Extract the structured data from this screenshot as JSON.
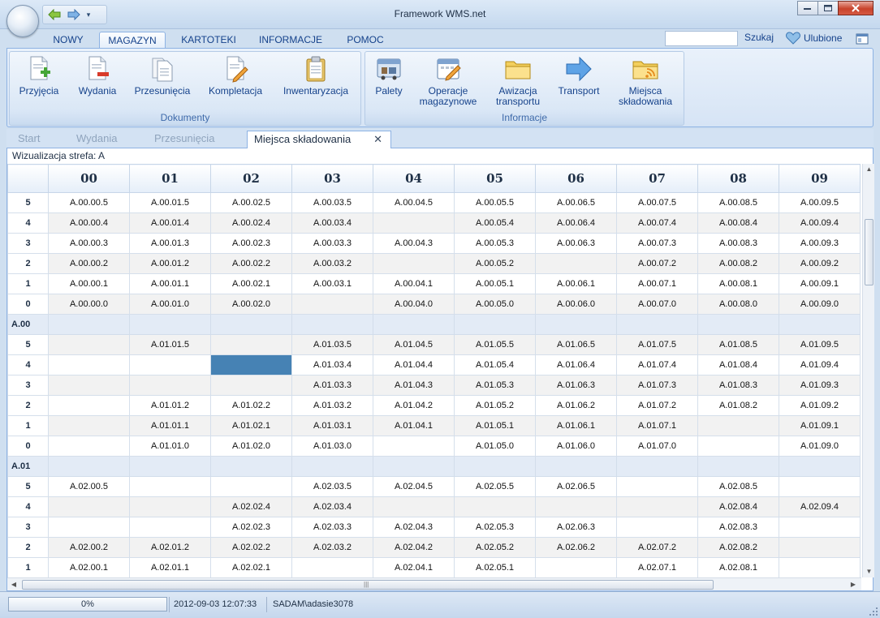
{
  "window": {
    "title": "Framework WMS.net"
  },
  "ribbon": {
    "tabs": [
      "NOWY",
      "MAGAZYN",
      "KARTOTEKI",
      "INFORMACJE",
      "POMOC"
    ],
    "active_tab": "MAGAZYN",
    "search": {
      "value": "",
      "label": "Szukaj"
    },
    "favorites_label": "Ulubione",
    "groups": [
      {
        "label": "Dokumenty",
        "buttons": [
          "Przyjęcia",
          "Wydania",
          "Przesunięcia",
          "Kompletacja",
          "Inwentaryzacja"
        ]
      },
      {
        "label": "Informacje",
        "buttons": [
          "Palety",
          "Operacje magazynowe",
          "Awizacja transportu",
          "Transport",
          "Miejsca składowania"
        ]
      }
    ]
  },
  "doc_tabs": [
    {
      "label": "Start",
      "active": false
    },
    {
      "label": "Wydania",
      "active": false
    },
    {
      "label": "Przesunięcia",
      "active": false
    },
    {
      "label": "Miejsca składowania",
      "active": true,
      "close": "✕"
    }
  ],
  "visualization": {
    "subtitle": "Wizualizacja strefa: A",
    "columns": [
      "00",
      "01",
      "02",
      "03",
      "04",
      "05",
      "06",
      "07",
      "08",
      "09"
    ],
    "rows": [
      {
        "label": "5",
        "cells": [
          "A.00.00.5",
          "A.00.01.5",
          "A.00.02.5",
          "A.00.03.5",
          "A.00.04.5",
          "A.00.05.5",
          "A.00.06.5",
          "A.00.07.5",
          "A.00.08.5",
          "A.00.09.5"
        ]
      },
      {
        "label": "4",
        "cells": [
          "A.00.00.4",
          "A.00.01.4",
          "A.00.02.4",
          "A.00.03.4",
          "",
          "A.00.05.4",
          "A.00.06.4",
          "A.00.07.4",
          "A.00.08.4",
          "A.00.09.4"
        ]
      },
      {
        "label": "3",
        "cells": [
          "A.00.00.3",
          "A.00.01.3",
          "A.00.02.3",
          "A.00.03.3",
          "A.00.04.3",
          "A.00.05.3",
          "A.00.06.3",
          "A.00.07.3",
          "A.00.08.3",
          "A.00.09.3"
        ]
      },
      {
        "label": "2",
        "cells": [
          "A.00.00.2",
          "A.00.01.2",
          "A.00.02.2",
          "A.00.03.2",
          "",
          "A.00.05.2",
          "",
          "A.00.07.2",
          "A.00.08.2",
          "A.00.09.2"
        ]
      },
      {
        "label": "1",
        "cells": [
          "A.00.00.1",
          "A.00.01.1",
          "A.00.02.1",
          "A.00.03.1",
          "A.00.04.1",
          "A.00.05.1",
          "A.00.06.1",
          "A.00.07.1",
          "A.00.08.1",
          "A.00.09.1"
        ]
      },
      {
        "label": "0",
        "cells": [
          "A.00.00.0",
          "A.00.01.0",
          "A.00.02.0",
          "",
          "A.00.04.0",
          "A.00.05.0",
          "A.00.06.0",
          "A.00.07.0",
          "A.00.08.0",
          "A.00.09.0"
        ]
      },
      {
        "label": "A.00",
        "group": true,
        "cells": [
          "",
          "",
          "",
          "",
          "",
          "",
          "",
          "",
          "",
          ""
        ]
      },
      {
        "label": "5",
        "cells": [
          "",
          "A.01.01.5",
          "",
          "A.01.03.5",
          "A.01.04.5",
          "A.01.05.5",
          "A.01.06.5",
          "A.01.07.5",
          "A.01.08.5",
          "A.01.09.5"
        ]
      },
      {
        "label": "4",
        "selected_col": 2,
        "cells": [
          "",
          "",
          "",
          "A.01.03.4",
          "A.01.04.4",
          "A.01.05.4",
          "A.01.06.4",
          "A.01.07.4",
          "A.01.08.4",
          "A.01.09.4"
        ]
      },
      {
        "label": "3",
        "cells": [
          "",
          "",
          "",
          "A.01.03.3",
          "A.01.04.3",
          "A.01.05.3",
          "A.01.06.3",
          "A.01.07.3",
          "A.01.08.3",
          "A.01.09.3"
        ]
      },
      {
        "label": "2",
        "cells": [
          "",
          "A.01.01.2",
          "A.01.02.2",
          "A.01.03.2",
          "A.01.04.2",
          "A.01.05.2",
          "A.01.06.2",
          "A.01.07.2",
          "A.01.08.2",
          "A.01.09.2"
        ]
      },
      {
        "label": "1",
        "cells": [
          "",
          "A.01.01.1",
          "A.01.02.1",
          "A.01.03.1",
          "A.01.04.1",
          "A.01.05.1",
          "A.01.06.1",
          "A.01.07.1",
          "",
          "A.01.09.1"
        ]
      },
      {
        "label": "0",
        "cells": [
          "",
          "A.01.01.0",
          "A.01.02.0",
          "A.01.03.0",
          "",
          "A.01.05.0",
          "A.01.06.0",
          "A.01.07.0",
          "",
          "A.01.09.0"
        ]
      },
      {
        "label": "A.01",
        "group": true,
        "cells": [
          "",
          "",
          "",
          "",
          "",
          "",
          "",
          "",
          "",
          ""
        ]
      },
      {
        "label": "5",
        "cells": [
          "A.02.00.5",
          "",
          "",
          "A.02.03.5",
          "A.02.04.5",
          "A.02.05.5",
          "A.02.06.5",
          "",
          "A.02.08.5",
          ""
        ]
      },
      {
        "label": "4",
        "cells": [
          "",
          "",
          "A.02.02.4",
          "A.02.03.4",
          "",
          "",
          "",
          "",
          "A.02.08.4",
          "A.02.09.4"
        ]
      },
      {
        "label": "3",
        "cells": [
          "",
          "",
          "A.02.02.3",
          "A.02.03.3",
          "A.02.04.3",
          "A.02.05.3",
          "A.02.06.3",
          "",
          "A.02.08.3",
          ""
        ]
      },
      {
        "label": "2",
        "cells": [
          "A.02.00.2",
          "A.02.01.2",
          "A.02.02.2",
          "A.02.03.2",
          "A.02.04.2",
          "A.02.05.2",
          "A.02.06.2",
          "A.02.07.2",
          "A.02.08.2",
          ""
        ]
      },
      {
        "label": "1",
        "cells": [
          "A.02.00.1",
          "A.02.01.1",
          "A.02.02.1",
          "",
          "A.02.04.1",
          "A.02.05.1",
          "",
          "A.02.07.1",
          "A.02.08.1",
          ""
        ]
      }
    ],
    "colors": {
      "selected": "#4682b4",
      "group_row": "#e3ebf6",
      "alt_row": "#f2f2f2"
    }
  },
  "status": {
    "progress": "0%",
    "progress_value": 0,
    "datetime": "2012-09-03 12:07:33",
    "user": "SADAM\\adasie3078"
  },
  "icons": {
    "przyjecia": "document-add-icon",
    "wydania": "document-remove-icon",
    "przesuniecia": "documents-icon",
    "kompletacja": "document-edit-icon",
    "inwentaryzacja": "clipboard-icon",
    "palety": "pallet-truck-icon",
    "operacje": "calendar-check-icon",
    "awizacja": "folder-icon",
    "transport": "arrow-right-icon",
    "miejsca": "folder-rss-icon"
  }
}
